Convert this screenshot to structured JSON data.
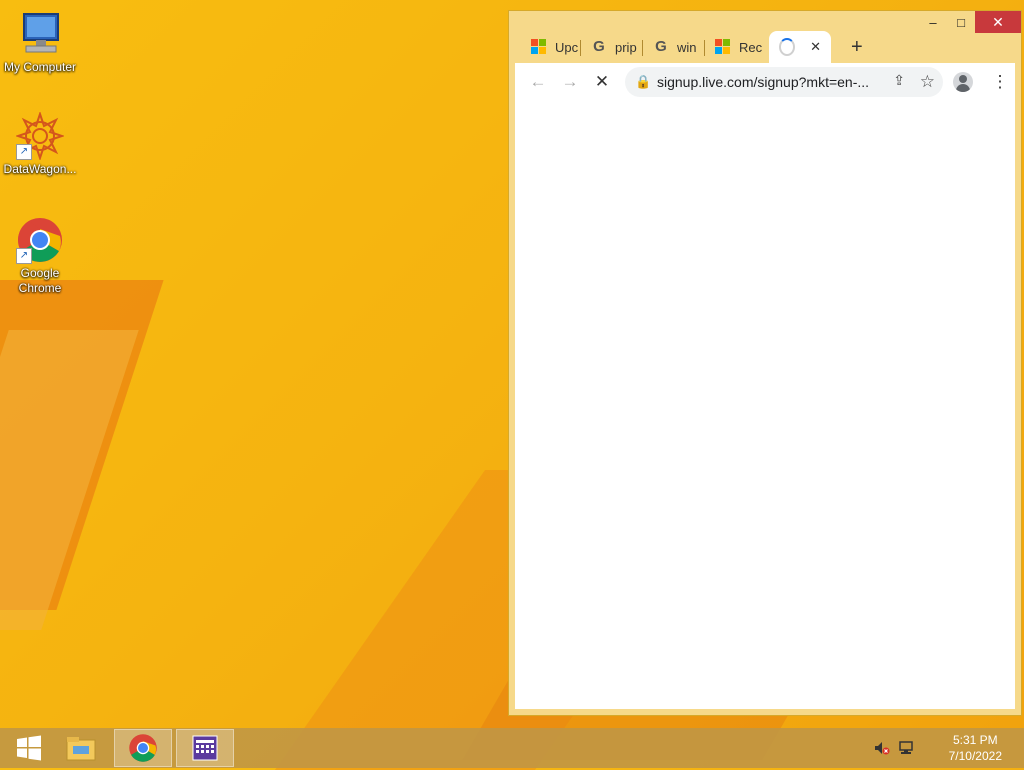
{
  "desktop": {
    "icons": [
      {
        "label": "My Computer",
        "icon": "computer-icon"
      },
      {
        "label": "DataWagon...",
        "icon": "datawagon-icon"
      },
      {
        "label": "Google Chrome",
        "icon": "chrome-icon"
      }
    ]
  },
  "browser": {
    "tabs": [
      {
        "title": "Upc",
        "favicon": "microsoft-icon"
      },
      {
        "title": "prip",
        "favicon": "google-icon"
      },
      {
        "title": "win",
        "favicon": "google-icon"
      },
      {
        "title": "Rec",
        "favicon": "microsoft-icon"
      },
      {
        "title": "",
        "favicon": "loading-spinner-icon",
        "active": true
      }
    ],
    "new_tab_label": "+",
    "close_tab_glyph": "✕",
    "url": "signup.live.com/signup?mkt=en-...",
    "window_controls": {
      "minimize": "–",
      "maximize": "□",
      "close": "✕"
    },
    "nav_glyphs": {
      "back": "←",
      "forward": "→",
      "stop": "✕",
      "menu": "⋮"
    }
  },
  "taskbar": {
    "time": "5:31 PM",
    "date": "7/10/2022",
    "items": [
      "start",
      "file-explorer",
      "chrome",
      "app"
    ]
  },
  "colors": {
    "wallpaper": "#f5b310",
    "taskbar": "#bf9646",
    "close_button": "#c8393c",
    "accent_blue": "#1a73e8"
  }
}
